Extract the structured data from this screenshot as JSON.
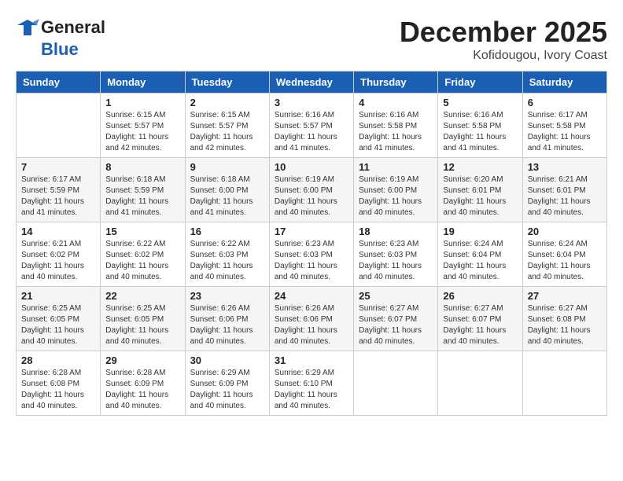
{
  "logo": {
    "line1": "General",
    "line2": "Blue"
  },
  "title": "December 2025",
  "subtitle": "Kofidougou, Ivory Coast",
  "days_of_week": [
    "Sunday",
    "Monday",
    "Tuesday",
    "Wednesday",
    "Thursday",
    "Friday",
    "Saturday"
  ],
  "weeks": [
    [
      {
        "day": "",
        "info": ""
      },
      {
        "day": "1",
        "info": "Sunrise: 6:15 AM\nSunset: 5:57 PM\nDaylight: 11 hours and 42 minutes."
      },
      {
        "day": "2",
        "info": "Sunrise: 6:15 AM\nSunset: 5:57 PM\nDaylight: 11 hours and 42 minutes."
      },
      {
        "day": "3",
        "info": "Sunrise: 6:16 AM\nSunset: 5:57 PM\nDaylight: 11 hours and 41 minutes."
      },
      {
        "day": "4",
        "info": "Sunrise: 6:16 AM\nSunset: 5:58 PM\nDaylight: 11 hours and 41 minutes."
      },
      {
        "day": "5",
        "info": "Sunrise: 6:16 AM\nSunset: 5:58 PM\nDaylight: 11 hours and 41 minutes."
      },
      {
        "day": "6",
        "info": "Sunrise: 6:17 AM\nSunset: 5:58 PM\nDaylight: 11 hours and 41 minutes."
      }
    ],
    [
      {
        "day": "7",
        "info": "Sunrise: 6:17 AM\nSunset: 5:59 PM\nDaylight: 11 hours and 41 minutes."
      },
      {
        "day": "8",
        "info": "Sunrise: 6:18 AM\nSunset: 5:59 PM\nDaylight: 11 hours and 41 minutes."
      },
      {
        "day": "9",
        "info": "Sunrise: 6:18 AM\nSunset: 6:00 PM\nDaylight: 11 hours and 41 minutes."
      },
      {
        "day": "10",
        "info": "Sunrise: 6:19 AM\nSunset: 6:00 PM\nDaylight: 11 hours and 40 minutes."
      },
      {
        "day": "11",
        "info": "Sunrise: 6:19 AM\nSunset: 6:00 PM\nDaylight: 11 hours and 40 minutes."
      },
      {
        "day": "12",
        "info": "Sunrise: 6:20 AM\nSunset: 6:01 PM\nDaylight: 11 hours and 40 minutes."
      },
      {
        "day": "13",
        "info": "Sunrise: 6:21 AM\nSunset: 6:01 PM\nDaylight: 11 hours and 40 minutes."
      }
    ],
    [
      {
        "day": "14",
        "info": "Sunrise: 6:21 AM\nSunset: 6:02 PM\nDaylight: 11 hours and 40 minutes."
      },
      {
        "day": "15",
        "info": "Sunrise: 6:22 AM\nSunset: 6:02 PM\nDaylight: 11 hours and 40 minutes."
      },
      {
        "day": "16",
        "info": "Sunrise: 6:22 AM\nSunset: 6:03 PM\nDaylight: 11 hours and 40 minutes."
      },
      {
        "day": "17",
        "info": "Sunrise: 6:23 AM\nSunset: 6:03 PM\nDaylight: 11 hours and 40 minutes."
      },
      {
        "day": "18",
        "info": "Sunrise: 6:23 AM\nSunset: 6:03 PM\nDaylight: 11 hours and 40 minutes."
      },
      {
        "day": "19",
        "info": "Sunrise: 6:24 AM\nSunset: 6:04 PM\nDaylight: 11 hours and 40 minutes."
      },
      {
        "day": "20",
        "info": "Sunrise: 6:24 AM\nSunset: 6:04 PM\nDaylight: 11 hours and 40 minutes."
      }
    ],
    [
      {
        "day": "21",
        "info": "Sunrise: 6:25 AM\nSunset: 6:05 PM\nDaylight: 11 hours and 40 minutes."
      },
      {
        "day": "22",
        "info": "Sunrise: 6:25 AM\nSunset: 6:05 PM\nDaylight: 11 hours and 40 minutes."
      },
      {
        "day": "23",
        "info": "Sunrise: 6:26 AM\nSunset: 6:06 PM\nDaylight: 11 hours and 40 minutes."
      },
      {
        "day": "24",
        "info": "Sunrise: 6:26 AM\nSunset: 6:06 PM\nDaylight: 11 hours and 40 minutes."
      },
      {
        "day": "25",
        "info": "Sunrise: 6:27 AM\nSunset: 6:07 PM\nDaylight: 11 hours and 40 minutes."
      },
      {
        "day": "26",
        "info": "Sunrise: 6:27 AM\nSunset: 6:07 PM\nDaylight: 11 hours and 40 minutes."
      },
      {
        "day": "27",
        "info": "Sunrise: 6:27 AM\nSunset: 6:08 PM\nDaylight: 11 hours and 40 minutes."
      }
    ],
    [
      {
        "day": "28",
        "info": "Sunrise: 6:28 AM\nSunset: 6:08 PM\nDaylight: 11 hours and 40 minutes."
      },
      {
        "day": "29",
        "info": "Sunrise: 6:28 AM\nSunset: 6:09 PM\nDaylight: 11 hours and 40 minutes."
      },
      {
        "day": "30",
        "info": "Sunrise: 6:29 AM\nSunset: 6:09 PM\nDaylight: 11 hours and 40 minutes."
      },
      {
        "day": "31",
        "info": "Sunrise: 6:29 AM\nSunset: 6:10 PM\nDaylight: 11 hours and 40 minutes."
      },
      {
        "day": "",
        "info": ""
      },
      {
        "day": "",
        "info": ""
      },
      {
        "day": "",
        "info": ""
      }
    ]
  ]
}
